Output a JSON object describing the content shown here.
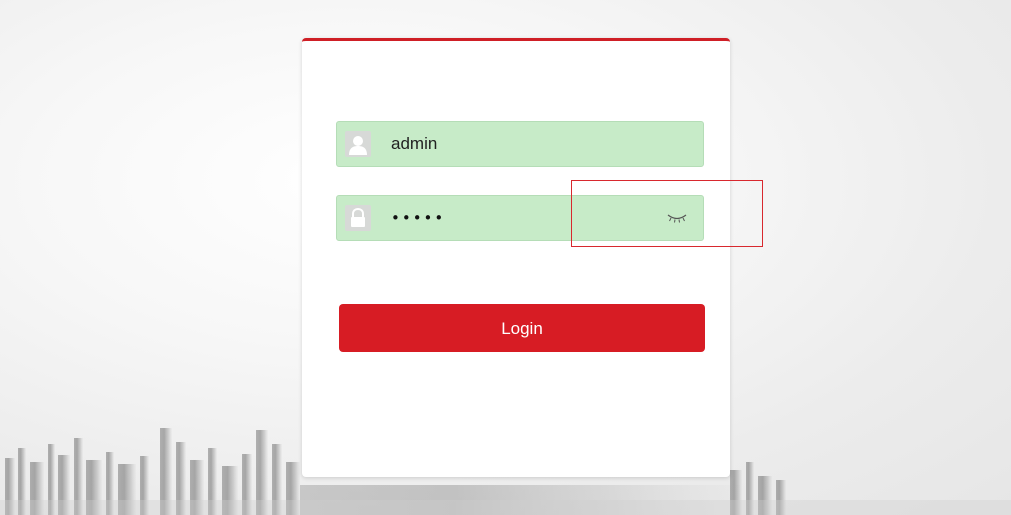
{
  "login_form": {
    "username_value": "admin",
    "password_masked": "•••••",
    "login_label": "Login"
  },
  "icons": {
    "username": "user-icon",
    "password": "lock-icon",
    "toggle_password": "eye-closed-icon"
  },
  "colors": {
    "accent": "#d71c24",
    "field_fill": "#c7ebc8",
    "annotation": "#d8282e"
  }
}
